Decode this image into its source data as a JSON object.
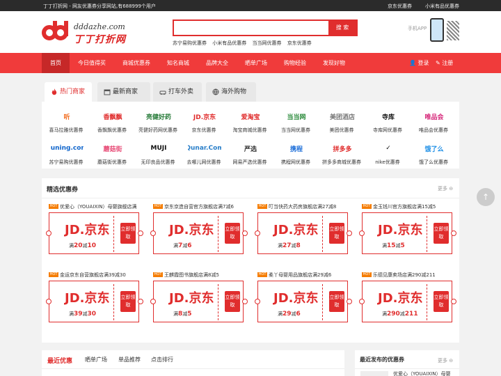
{
  "topbar": {
    "left": "丁丁打折网 - 网友优惠券分享网站,有688999个用户",
    "right": [
      "京东优惠券",
      "小米有品优惠券"
    ]
  },
  "logo": {
    "en": "dddazhe.com",
    "cn": "丁丁打折网"
  },
  "search": {
    "placeholder": "",
    "button": "搜 索"
  },
  "hotlinks": [
    "苏宁易购优惠券",
    "小米有品优惠券",
    "当当网优惠券",
    "京东优惠券"
  ],
  "app_label": "手机APP",
  "nav": {
    "items": [
      "首页",
      "今日值得买",
      "商城优惠券",
      "知名商城",
      "品牌大全",
      "晒单广场",
      "购物经验",
      "发现好物"
    ],
    "login": "登录",
    "register": "注册"
  },
  "tabs": [
    "热门商家",
    "最新商家",
    "打车外卖",
    "海外购物"
  ],
  "brands": [
    {
      "logo": "听",
      "name": "喜马拉雅优惠券",
      "color": "#f26b1d"
    },
    {
      "logo": "香飘飘",
      "name": "香飘飘优惠券",
      "color": "#e02d2d"
    },
    {
      "logo": "亮健好药",
      "name": "亮健好药网优惠券",
      "color": "#2a7d3c"
    },
    {
      "logo": "JD.京东",
      "name": "京东优惠券",
      "color": "#e02d2d"
    },
    {
      "logo": "爱淘宝",
      "name": "淘宝商城优惠券",
      "color": "#e02d2d"
    },
    {
      "logo": "当当网",
      "name": "当当网优惠券",
      "color": "#2a8a3a"
    },
    {
      "logo": "美团酒店",
      "name": "美团优惠券",
      "color": "#777777"
    },
    {
      "logo": "寺库",
      "name": "寺库网优惠券",
      "color": "#111111"
    },
    {
      "logo": "唯品会",
      "name": "唯品会优惠券",
      "color": "#d6287a"
    },
    {
      "logo": "Suning.com",
      "name": "苏宁易购优惠券",
      "color": "#1166cc"
    },
    {
      "logo": "蘑菇街",
      "name": "蘑菇街优惠券",
      "color": "#e8507a"
    },
    {
      "logo": "MUJI",
      "name": "无印良品优惠券",
      "color": "#111111"
    },
    {
      "logo": "Qunar.Com",
      "name": "去哪儿网优惠券",
      "color": "#2a7fc9"
    },
    {
      "logo": "严选",
      "name": "网易严选优惠券",
      "color": "#333333"
    },
    {
      "logo": "携程",
      "name": "携程网优惠券",
      "color": "#1e6fd9"
    },
    {
      "logo": "拼多多",
      "name": "拼多多商城优惠券",
      "color": "#e02d2d"
    },
    {
      "logo": "✓",
      "name": "nike优惠券",
      "color": "#111111"
    },
    {
      "logo": "饿了么",
      "name": "饿了么优惠券",
      "color": "#1e8fe6"
    }
  ],
  "selected": {
    "title": "精选优惠券",
    "more": "更多",
    "brand_text": "JD.京东",
    "get_label": "立即领取",
    "badge": "HOT",
    "coupons": [
      {
        "caption": "优爱心（YOUAIXIN）母婴旗舰店满",
        "full": "20",
        "cut": "10"
      },
      {
        "caption": "京东京造自营官方旗舰店满7减6",
        "full": "7",
        "cut": "6"
      },
      {
        "caption": "叮当快药大药房旗舰店满27减8",
        "full": "27",
        "cut": "8"
      },
      {
        "caption": "金玉钱川官方旗舰店满15减5",
        "full": "15",
        "cut": "5"
      },
      {
        "caption": "金运京东自营旗舰店满39减30",
        "full": "39",
        "cut": "30"
      },
      {
        "caption": "王麒霞图书旗舰店满8减5",
        "full": "8",
        "cut": "5"
      },
      {
        "caption": "柔丫母婴用品旗舰店满29减6",
        "full": "29",
        "cut": "6"
      },
      {
        "caption": "乐德见康卖场店满290减211",
        "full": "290",
        "cut": "211"
      }
    ]
  },
  "recent": {
    "tabs": [
      "最近优惠",
      "晒单广场",
      "单品推荐",
      "点击排行"
    ]
  },
  "latest": {
    "title": "最近发布的优惠券",
    "more": "更多",
    "first_item": "优爱心（YOUAIXIN）母婴"
  }
}
